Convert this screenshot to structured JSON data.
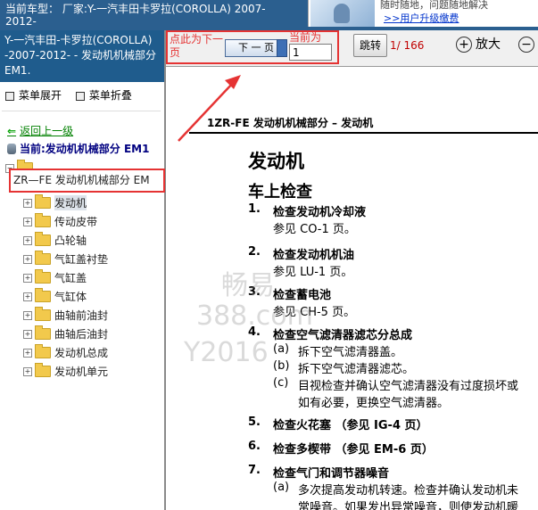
{
  "top": {
    "vehicle_label": "当前车型： 厂家:Y-一汽丰田卡罗拉(COROLLA) 2007-2012-",
    "promo_text": "随时随地，问题随地解决",
    "promo_link": ">>用户升级缴费"
  },
  "sidebar": {
    "title": "Y-一汽丰田-卡罗拉(COROLLA) -2007-2012- - 发动机机械部分 EM1.",
    "expand_label": "菜单展开",
    "collapse_label": "菜单折叠",
    "back_label": "返回上一级",
    "current_label": "当前:发动机机械部分 EM1",
    "root_label": "ZR—FE 发动机机械部分 EM",
    "items": [
      {
        "label": "发动机"
      },
      {
        "label": "传动皮带"
      },
      {
        "label": "凸轮轴"
      },
      {
        "label": "气缸盖衬垫"
      },
      {
        "label": "气缸盖"
      },
      {
        "label": "气缸体"
      },
      {
        "label": "曲轴前油封"
      },
      {
        "label": "曲轴后油封"
      },
      {
        "label": "发动机总成"
      },
      {
        "label": "发动机单元"
      }
    ]
  },
  "toolbar": {
    "annotation_text": "点此为下一页",
    "next_label": "下 一 页",
    "current_label": "当前为",
    "page_value": "1",
    "jump_label": "跳转",
    "page_count": "1/ 166",
    "zoom_in_label": "放大"
  },
  "document": {
    "header": "1ZR-FE 发动机机械部分 – 发动机",
    "title": "发动机",
    "subtitle": "车上检查",
    "watermark1": "畅易",
    "watermark2": "388.com",
    "watermark3": "Y2016",
    "steps": [
      {
        "num": "1.",
        "title": "检查发动机冷却液",
        "sub": "参见 CO-1 页。"
      },
      {
        "num": "2.",
        "title": "检查发动机机油",
        "sub": "参见 LU-1 页。"
      },
      {
        "num": "3.",
        "title": "检查蓄电池",
        "sub": "参见 CH-5 页。"
      },
      {
        "num": "4.",
        "title": "检查空气滤清器滤芯分总成",
        "sub": ""
      },
      {
        "num": "5.",
        "title": "检查火花塞 （参见 IG-4 页）",
        "sub": ""
      },
      {
        "num": "6.",
        "title": "检查多楔带 （参见 EM-6 页）",
        "sub": ""
      },
      {
        "num": "7.",
        "title": "检查气门和调节器噪音",
        "sub": ""
      }
    ],
    "step4_items": [
      {
        "k": "(a)",
        "v": "拆下空气滤清器盖。"
      },
      {
        "k": "(b)",
        "v": "拆下空气滤清器滤芯。"
      },
      {
        "k": "(c)",
        "v": "目视检查并确认空气滤清器没有过度损坏或"
      },
      {
        "k": "",
        "v": "如有必要，更换空气滤清器。"
      }
    ],
    "step7_items": [
      {
        "k": "(a)",
        "v": "多次提高发动机转速。检查并确认发动机未"
      },
      {
        "k": "",
        "v": "常噪音。如果发出异常噪音，则使发动机暖"
      }
    ]
  },
  "colors": {
    "annotation_red": "#e53333",
    "header_blue": "#1f5c8d",
    "link_green": "#008000"
  }
}
